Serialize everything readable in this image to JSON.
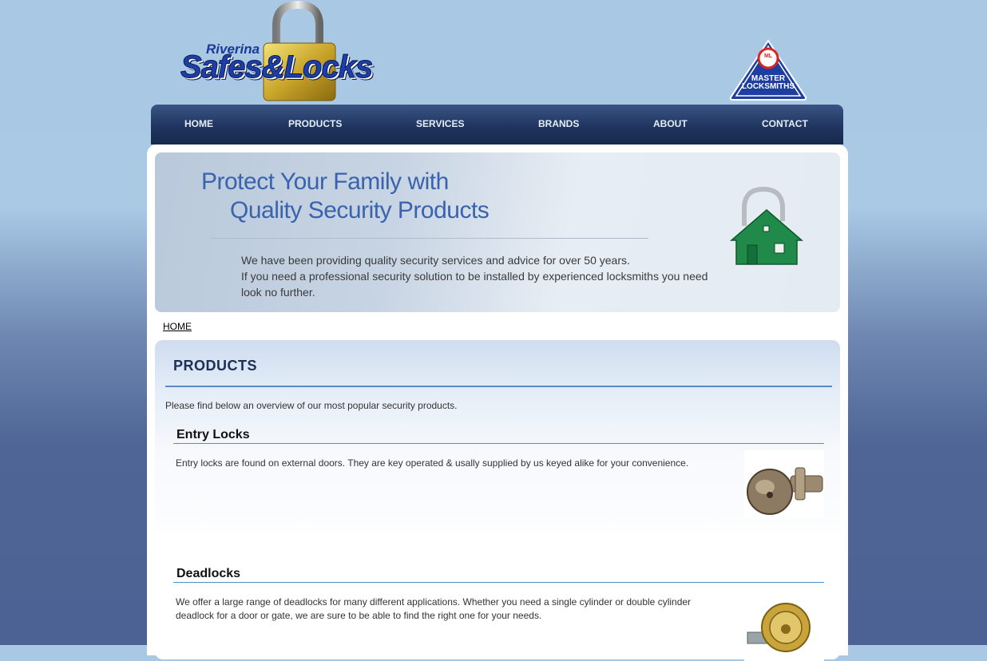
{
  "header": {
    "logo_small": "Riverina",
    "logo_main": "Safes&Locks",
    "badge_text_line1": "MASTER",
    "badge_text_line2": "LOCKSMITHS",
    "badge_initials": "ML"
  },
  "nav": {
    "items": [
      {
        "label": "HOME"
      },
      {
        "label": "PRODUCTS"
      },
      {
        "label": "SERVICES"
      },
      {
        "label": "BRANDS"
      },
      {
        "label": "ABOUT"
      },
      {
        "label": "CONTACT"
      }
    ]
  },
  "banner": {
    "heading_line1": "Protect Your Family with",
    "heading_line2": "Quality Security Products",
    "line1": "We have been providing quality security services and advice for over 50 years.",
    "line2": "If you need a professional security solution to be installed by experienced locksmiths you need look no further."
  },
  "breadcrumb": "HOME",
  "products": {
    "title": "PRODUCTS",
    "intro": "Please find below an overview of our most popular security products.",
    "sections": [
      {
        "title": "Entry Locks",
        "text": "Entry locks are found on external doors. They are key operated & usally supplied by us keyed alike for your convenience."
      },
      {
        "title": "Deadlocks",
        "text": "We offer a large range of deadlocks for many different applications. Whether you need a single cylinder or double cylinder deadlock for a door or gate, we are sure to be able to find the right one for your needs."
      }
    ]
  },
  "colors": {
    "nav_bg": "#1f3560",
    "heading_blue": "#3a63ad",
    "rule_blue": "#4f90c8"
  }
}
